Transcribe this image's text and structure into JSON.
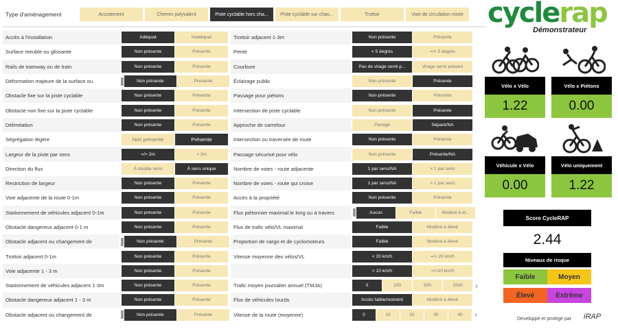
{
  "type_bar": {
    "label": "Type d'aménagement",
    "tabs": [
      {
        "label": "Accotement",
        "selected": false
      },
      {
        "label": "Chemin polyvalent",
        "selected": false
      },
      {
        "label": "Piste cyclable hors cha...",
        "selected": true
      },
      {
        "label": "Piste cyclable sur chau...",
        "selected": false
      },
      {
        "label": "Trottoir",
        "selected": false
      },
      {
        "label": "Voie de circulation mixte",
        "selected": false
      }
    ]
  },
  "left_attributes": [
    {
      "label": "Accès à l'installation",
      "options": [
        "Adéquat",
        "Inadéquat"
      ],
      "selected": 0
    },
    {
      "label": "Surface meuble ou glissante",
      "options": [
        "Non présente",
        "Présente"
      ],
      "selected": 0
    },
    {
      "label": "Rails de tramway ou de train",
      "options": [
        "Non présente",
        "Présente"
      ],
      "selected": 0
    },
    {
      "label": "Déformation majeure de la surface ou",
      "options": [
        "Non présente",
        "Présente"
      ],
      "selected": 0,
      "scroll": true
    },
    {
      "label": "Obstacle fixe sur la piste cyclable",
      "options": [
        "Non présente",
        "Présente"
      ],
      "selected": 0
    },
    {
      "label": "Obstacle non fixe sur la piste cyclable",
      "options": [
        "Non présente",
        "Présente"
      ],
      "selected": 0
    },
    {
      "label": "Délimitation",
      "options": [
        "Non présente",
        "Présente"
      ],
      "selected": 0
    },
    {
      "label": "Ségrégation légère",
      "options": [
        "Non présente",
        "Présente"
      ],
      "selected": 1,
      "big": true
    },
    {
      "label": "Largeur de la piste par sens",
      "options": [
        "=/> 2m",
        "< 2m"
      ],
      "selected": 0
    },
    {
      "label": "Direction du flux",
      "options": [
        "À double sens",
        "À sens unique"
      ],
      "selected": 1
    },
    {
      "label": "Restriction de largeur",
      "options": [
        "Non présente",
        "Présente"
      ],
      "selected": 0
    },
    {
      "label": "Voie adjacente de la route 0-1m",
      "options": [
        "Non présente",
        "Présente"
      ],
      "selected": 0
    },
    {
      "label": "Stationnement de véhicules adjacent 0-1m",
      "options": [
        "Non présente",
        "Présente"
      ],
      "selected": 0
    },
    {
      "label": "Obstacle dangereux adjacent 0-1 m",
      "options": [
        "Non présente",
        "Présente"
      ],
      "selected": 0
    },
    {
      "label": "Obstacle adjacent ou changement de",
      "options": [
        "Non présente",
        "Présente"
      ],
      "selected": 0,
      "scroll": true
    },
    {
      "label": "Trottoir adjacent 0-1m",
      "options": [
        "Non présente",
        "Présente"
      ],
      "selected": 0
    },
    {
      "label": "Voie adjacente 1 - 3 m",
      "options": [
        "Non présente",
        "Présente"
      ],
      "selected": 0
    },
    {
      "label": "Stationnement de véhicules adjacent 1-3m",
      "options": [
        "Non présente",
        "Présente"
      ],
      "selected": 0
    },
    {
      "label": "Obstacle dangereux adjacent 1 - 3 m",
      "options": [
        "Non présente",
        "Présente"
      ],
      "selected": 0
    },
    {
      "label": "Obstacle adjacent ou changement de",
      "options": [
        "Non présente",
        "Présente"
      ],
      "selected": 0,
      "scroll": true
    }
  ],
  "middle_attributes": [
    {
      "label": "Trottoir adjacent 1-3m",
      "options": [
        "Non présente",
        "Présente"
      ],
      "selected": 0
    },
    {
      "label": "Pente",
      "options": [
        "< 5 degrés",
        "=/> 5 degrés"
      ],
      "selected": 0
    },
    {
      "label": "Courbure",
      "options": [
        "Pas de virage serré p...",
        "Virage serré présent"
      ],
      "selected": 0
    },
    {
      "label": "Éclairage public",
      "options": [
        "Non présente",
        "Présente"
      ],
      "selected": 1
    },
    {
      "label": "Passage pour piétons",
      "options": [
        "Non présente",
        "Présente"
      ],
      "selected": 0
    },
    {
      "label": "Intersection de piste cyclable",
      "options": [
        "Non présente",
        "Présente"
      ],
      "selected": 1
    },
    {
      "label": "Approche de carrefour",
      "options": [
        "Partagé",
        "Séparé/NA"
      ],
      "selected": 1
    },
    {
      "label": "Intersection ou traversée de route",
      "options": [
        "Non présente",
        "Présente"
      ],
      "selected": 0
    },
    {
      "label": "Passage sécurisé pour vélo",
      "options": [
        "Non présente",
        "Présente/NA"
      ],
      "selected": 1
    },
    {
      "label": "Nombre de voies - route adjacente",
      "options": [
        "1 par sens/NA",
        "> 1 par sens"
      ],
      "selected": 0
    },
    {
      "label": "Nombre de voies - route qui croise",
      "options": [
        "1 par sens/NA",
        "> 1 par sens"
      ],
      "selected": 0
    },
    {
      "label": "Accès à la propriété",
      "options": [
        "Non présente",
        "Présente"
      ],
      "selected": 0
    },
    {
      "label": "Flux piétonnier maximal le long ou à travers",
      "options": [
        "Aucun",
        "Faible",
        "Modéré à él..."
      ],
      "selected": 0,
      "scroll": true
    },
    {
      "label": "Flux de trafic vélo/VL maximal",
      "options": [
        "Faible",
        "Modéré à élevé"
      ],
      "selected": 0
    },
    {
      "label": "Proportion de cargo et de cyclomoteurs",
      "options": [
        "Faible",
        "Modéré à élevé"
      ],
      "selected": 0
    },
    {
      "label": "Vitesse moyenne des vélos/VL",
      "options": [
        "< 20 km/h",
        "=/> 20 km/h"
      ],
      "selected": 0
    },
    {
      "label": "",
      "options": [
        "< 10 km/h",
        "=/>10 km/h"
      ],
      "selected": 0
    },
    {
      "label": "Trafic moyen journalier annuel (TMJA)",
      "options": [
        "0",
        "100",
        "500",
        "1500"
      ],
      "selected": -1,
      "first_dark": true,
      "chevron": true
    },
    {
      "label": "Flux de véhicules lourds",
      "options": [
        "Accès faible/restreint",
        "Modéré à élevé"
      ],
      "selected": 0
    },
    {
      "label": "Vitesse de la route (moyenne)",
      "options": [
        "0",
        "10",
        "20",
        "30",
        "40"
      ],
      "selected": 0,
      "chevron": true
    }
  ],
  "brand": {
    "logo_a": "cycle",
    "logo_b": "rap",
    "subtitle": "Démonstrateur"
  },
  "risk_cards": [
    {
      "title": "Vélo x Vélo",
      "value": "1.22",
      "icon": "bike-bike-collision-icon"
    },
    {
      "title": "Vélo x Piétons",
      "value": "0.00",
      "icon": "bike-pedestrian-collision-icon"
    },
    {
      "title": "Véhicule x Vélo",
      "value": "0.00",
      "icon": "car-bike-collision-icon"
    },
    {
      "title": "Vélo uniquement",
      "value": "1.22",
      "icon": "bike-only-fall-icon"
    }
  ],
  "score": {
    "title": "Score CycleRAP",
    "value": "2.44"
  },
  "risk_levels": {
    "title": "Niveaux de risque",
    "levels": [
      {
        "label": "Faible",
        "color": "#8cc63f"
      },
      {
        "label": "Moyen",
        "color": "#f5c518"
      },
      {
        "label": "Élevé",
        "color": "#f26522"
      },
      {
        "label": "Extrême",
        "color": "#c845e0"
      }
    ]
  },
  "credit": {
    "text": "Développé et protégé par",
    "brand": "iRAP"
  },
  "colors": {
    "selected": "#333333",
    "unselected": "#f7e7b4",
    "accent_green": "#8cc63f",
    "brand_green": "#1f8a3e"
  }
}
